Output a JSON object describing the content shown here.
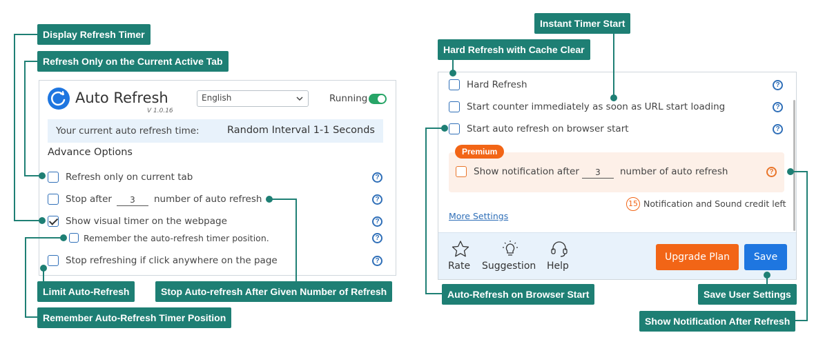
{
  "callouts": {
    "display_refresh_timer": "Display Refresh Timer",
    "refresh_only_current_tab": "Refresh Only on the Current Active Tab",
    "limit_auto_refresh": "Limit Auto-Refresh",
    "stop_after_given_number": "Stop Auto-refresh After Given Number of Refresh",
    "remember_timer_position": "Remember Auto-Refresh Timer Position",
    "instant_timer_start": "Instant Timer Start",
    "hard_refresh_cache_clear": "Hard Refresh with Cache Clear",
    "auto_refresh_browser_start": "Auto-Refresh on Browser Start",
    "save_user_settings": "Save User Settings",
    "show_notification_after_refresh": "Show Notification After Refresh"
  },
  "left_panel": {
    "app_title": "Auto Refresh",
    "version": "V 1.0.16",
    "language": {
      "selected": "English"
    },
    "status": "Running",
    "current_time_label": "Your current auto refresh time:",
    "current_time_value": "Random Interval 1-1 Seconds",
    "section_title": "Advance Options",
    "options": {
      "refresh_current_tab": "Refresh only on current tab",
      "stop_after_prefix": "Stop after",
      "stop_after_value": "3",
      "stop_after_suffix": "number of auto refresh",
      "show_visual_timer": "Show visual timer on the webpage",
      "remember_position": "Remember the auto-refresh timer position.",
      "stop_on_click": "Stop refreshing if click anywhere on the page"
    }
  },
  "right_panel": {
    "hard_refresh": "Hard Refresh",
    "start_immediately": "Start counter immediately as soon as URL start loading",
    "start_on_browser": "Start auto refresh on browser start",
    "premium_badge": "Premium",
    "notify_prefix": "Show notification after",
    "notify_value": "3",
    "notify_suffix": "number of auto refresh",
    "credit_count": "15",
    "credit_text": "Notification and Sound credit left",
    "more_settings": "More Settings",
    "footer": {
      "rate": "Rate",
      "suggestion": "Suggestion",
      "help": "Help",
      "upgrade": "Upgrade Plan",
      "save": "Save"
    }
  },
  "colors": {
    "callout": "#1e7f74",
    "checkbox": "#2f6fb8",
    "premium": "#e9752a",
    "save": "#1e76e0",
    "upgrade": "#f26516"
  }
}
